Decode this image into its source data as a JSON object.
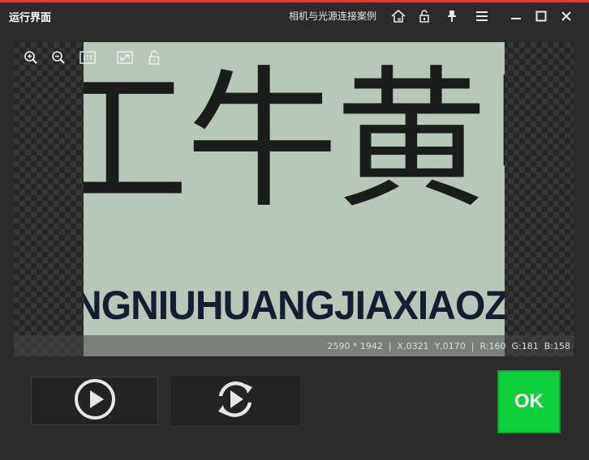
{
  "window": {
    "title": "运行界面",
    "subtitle": "相机与光源连接案例"
  },
  "titlebar_icons": [
    "home-icon",
    "unlock-icon",
    "pin-icon",
    "menu-icon",
    "minimize-icon",
    "maximize-icon",
    "close-icon"
  ],
  "viewer": {
    "tools": [
      "zoom-in-icon",
      "zoom-out-icon",
      "actual-size-icon",
      "fit-window-icon",
      "lock-icon"
    ],
    "image": {
      "hanzi_text": "工牛黄甲砖",
      "pinyin_text": "NGNIUHUANGJIAXIAOZU"
    },
    "status": {
      "resolution": "2590 * 1942",
      "x": "X,0321",
      "y": "Y,0170",
      "r": "R:160",
      "g": "G:181",
      "b": "B:158"
    }
  },
  "buttons": {
    "run_once": "run-once-icon",
    "run_loop": "run-loop-icon",
    "ok_label": "OK"
  },
  "colors": {
    "accent_red": "#e53935",
    "ok_green": "#0dd13b",
    "background": "#2b2b2b"
  }
}
